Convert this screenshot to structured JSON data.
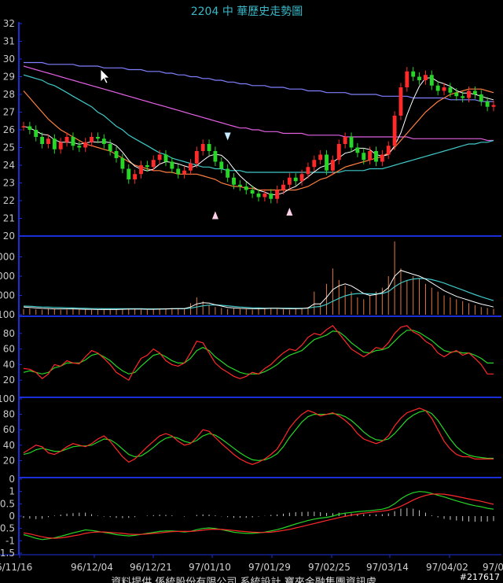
{
  "title": "2204  中    華歷史走勢圖",
  "footer": "資料提供  係統股份有限公司  系統設計  寶來金融集團資訊處",
  "watermark": "#217617",
  "colors": {
    "up": "#ff2a2a",
    "down": "#27d627",
    "frame": "#1b2fd8",
    "ma5": "#ffffff",
    "ma10": "#e0e060",
    "ma20": "#ff8040",
    "ma60": "#40c8c8",
    "ma120": "#e060e0",
    "ma240": "#8080ff"
  },
  "chart_data": [
    {
      "type": "candlestick",
      "ylim": [
        20,
        32
      ],
      "yticks": [
        "32",
        "31",
        "30",
        "29",
        "28",
        "27",
        "26",
        "25",
        "24",
        "23",
        "22",
        "21",
        "20"
      ],
      "x_labels": [
        "6/11/16",
        "96/12/04",
        "96/12/21",
        "97/01/10",
        "97/01/29",
        "97/02/25",
        "97/03/14",
        "97/04/02",
        "97/04/2"
      ],
      "close": [
        26.2,
        26.0,
        25.6,
        25.2,
        25.5,
        24.9,
        25.3,
        25.6,
        25.1,
        25.0,
        25.3,
        25.6,
        25.5,
        25.2,
        24.8,
        24.4,
        23.8,
        23.2,
        23.5,
        24.0,
        23.9,
        24.3,
        24.6,
        24.2,
        23.8,
        23.5,
        23.7,
        24.1,
        24.8,
        25.2,
        24.8,
        24.2,
        23.8,
        23.3,
        22.9,
        22.8,
        22.6,
        22.4,
        22.2,
        22.4,
        22.1,
        22.6,
        22.9,
        23.3,
        23.1,
        23.5,
        23.9,
        24.3,
        24.6,
        23.7,
        24.3,
        25.2,
        25.6,
        25.0,
        24.7,
        24.3,
        24.8,
        24.2,
        24.6,
        25.1,
        26.8,
        28.4,
        29.3,
        29.0,
        28.8,
        29.1,
        28.5,
        28.2,
        28.4,
        28.1,
        27.9,
        27.8,
        28.2,
        28.0,
        27.6,
        27.3,
        27.4
      ],
      "ma20": [
        28.2,
        27.8,
        27.4,
        27.0,
        26.6,
        26.3,
        26.0,
        25.8,
        25.6,
        25.4,
        25.2,
        25.1,
        25.0,
        24.9,
        24.8,
        24.6,
        24.4,
        24.2,
        24.0,
        23.9,
        23.8,
        23.7,
        23.7,
        23.6,
        23.6,
        23.5,
        23.5,
        23.5,
        23.5,
        23.4,
        23.3,
        23.2,
        23.0,
        22.9,
        22.8,
        22.8,
        22.7,
        22.7,
        22.6,
        22.6,
        22.6,
        22.6,
        22.6,
        22.6,
        22.6,
        22.7,
        22.8,
        23.0,
        23.2,
        23.3,
        23.5,
        23.7,
        23.9,
        24.0,
        24.1,
        24.2,
        24.3,
        24.4,
        24.5,
        24.7,
        25.0,
        25.4,
        25.8,
        26.2,
        26.6,
        27.0,
        27.3,
        27.6,
        27.8,
        28.0,
        28.1,
        28.2,
        28.3,
        28.3,
        28.3,
        28.2,
        28.1
      ],
      "ma60": [
        29.1,
        29.0,
        28.9,
        28.8,
        28.6,
        28.5,
        28.3,
        28.1,
        27.9,
        27.7,
        27.5,
        27.3,
        27.0,
        26.8,
        26.5,
        26.2,
        26.0,
        25.7,
        25.5,
        25.3,
        25.1,
        24.9,
        24.7,
        24.6,
        24.4,
        24.3,
        24.2,
        24.1,
        24.0,
        23.9,
        23.9,
        23.8,
        23.8,
        23.7,
        23.7,
        23.7,
        23.6,
        23.6,
        23.6,
        23.6,
        23.6,
        23.6,
        23.6,
        23.6,
        23.6,
        23.6,
        23.6,
        23.6,
        23.6,
        23.6,
        23.6,
        23.6,
        23.7,
        23.7,
        23.7,
        23.7,
        23.8,
        23.8,
        23.8,
        23.9,
        24.0,
        24.1,
        24.2,
        24.3,
        24.4,
        24.5,
        24.6,
        24.7,
        24.8,
        24.9,
        25.0,
        25.1,
        25.2,
        25.2,
        25.3,
        25.3,
        25.4
      ],
      "ma120": [
        29.6,
        29.5,
        29.4,
        29.3,
        29.2,
        29.1,
        29.0,
        28.9,
        28.8,
        28.7,
        28.6,
        28.5,
        28.4,
        28.3,
        28.2,
        28.1,
        28.0,
        27.9,
        27.8,
        27.7,
        27.6,
        27.5,
        27.4,
        27.3,
        27.2,
        27.1,
        27.0,
        26.9,
        26.8,
        26.7,
        26.6,
        26.5,
        26.4,
        26.3,
        26.2,
        26.1,
        26.1,
        26.0,
        26.0,
        25.9,
        25.9,
        25.9,
        25.8,
        25.8,
        25.8,
        25.8,
        25.7,
        25.7,
        25.7,
        25.7,
        25.7,
        25.7,
        25.6,
        25.6,
        25.6,
        25.6,
        25.6,
        25.6,
        25.6,
        25.6,
        25.6,
        25.6,
        25.6,
        25.5,
        25.5,
        25.5,
        25.5,
        25.5,
        25.5,
        25.5,
        25.5,
        25.5,
        25.5,
        25.5,
        25.5,
        25.4,
        25.4
      ],
      "ma240": [
        29.8,
        29.8,
        29.8,
        29.8,
        29.7,
        29.7,
        29.7,
        29.7,
        29.7,
        29.6,
        29.6,
        29.6,
        29.6,
        29.5,
        29.5,
        29.5,
        29.5,
        29.4,
        29.4,
        29.4,
        29.3,
        29.3,
        29.3,
        29.2,
        29.2,
        29.1,
        29.1,
        29.0,
        29.0,
        28.9,
        28.9,
        28.8,
        28.8,
        28.7,
        28.7,
        28.6,
        28.6,
        28.5,
        28.5,
        28.5,
        28.4,
        28.4,
        28.4,
        28.3,
        28.3,
        28.3,
        28.2,
        28.2,
        28.2,
        28.1,
        28.1,
        28.1,
        28.1,
        28.0,
        28.0,
        28.0,
        28.0,
        28.0,
        27.9,
        27.9,
        27.9,
        27.9,
        27.9,
        27.8,
        27.8,
        27.8,
        27.8,
        27.8,
        27.8,
        27.7,
        27.7,
        27.7,
        27.7,
        27.7,
        27.6,
        27.6,
        27.6
      ],
      "markers": [
        {
          "index": 33,
          "kind": "down",
          "price": 25.4
        },
        {
          "index": 31,
          "kind": "up",
          "price": 21.4
        },
        {
          "index": 43,
          "kind": "up",
          "price": 21.6
        }
      ]
    },
    {
      "type": "bar",
      "ylim": [
        0,
        4000
      ],
      "yticks": [
        "000",
        "000",
        "000",
        "100"
      ],
      "values": [
        300,
        320,
        280,
        260,
        300,
        280,
        250,
        260,
        300,
        270,
        260,
        250,
        240,
        260,
        280,
        260,
        300,
        320,
        280,
        260,
        250,
        270,
        300,
        320,
        340,
        300,
        280,
        600,
        900,
        700,
        500,
        400,
        350,
        300,
        320,
        300,
        280,
        260,
        300,
        350,
        320,
        300,
        280,
        260,
        300,
        350,
        400,
        1200,
        600,
        1600,
        2400,
        1800,
        1500,
        1200,
        900,
        800,
        1000,
        1200,
        1400,
        2000,
        3800,
        2400,
        1800,
        2000,
        1900,
        1600,
        1400,
        1200,
        1000,
        900,
        800,
        700,
        600,
        500,
        400,
        350,
        300
      ],
      "line_a": [
        400,
        380,
        350,
        330,
        320,
        300,
        300,
        300,
        300,
        290,
        280,
        280,
        270,
        270,
        270,
        270,
        280,
        290,
        290,
        290,
        280,
        280,
        290,
        300,
        310,
        320,
        320,
        400,
        560,
        620,
        600,
        520,
        450,
        380,
        350,
        330,
        320,
        310,
        310,
        320,
        330,
        330,
        320,
        310,
        310,
        320,
        350,
        560,
        560,
        900,
        1300,
        1500,
        1600,
        1500,
        1300,
        1100,
        1000,
        1050,
        1150,
        1400,
        2000,
        2300,
        2200,
        2100,
        2000,
        1850,
        1650,
        1450,
        1250,
        1100,
        950,
        850,
        750,
        650,
        550,
        480,
        400
      ],
      "line_b": [
        450,
        440,
        420,
        400,
        390,
        380,
        370,
        360,
        350,
        340,
        330,
        320,
        320,
        310,
        310,
        310,
        310,
        310,
        310,
        310,
        300,
        300,
        300,
        300,
        310,
        310,
        310,
        340,
        400,
        460,
        500,
        510,
        490,
        460,
        430,
        400,
        380,
        360,
        350,
        340,
        340,
        340,
        340,
        340,
        330,
        330,
        340,
        400,
        430,
        540,
        700,
        850,
        980,
        1060,
        1100,
        1100,
        1080,
        1080,
        1100,
        1200,
        1450,
        1650,
        1780,
        1850,
        1880,
        1870,
        1820,
        1740,
        1640,
        1520,
        1400,
        1280,
        1160,
        1040,
        930,
        830,
        730
      ]
    },
    {
      "type": "line",
      "ylim": [
        0,
        100
      ],
      "yticks": [
        "80",
        "60",
        "40",
        "20"
      ],
      "series": [
        {
          "values": [
            35,
            34,
            30,
            22,
            28,
            40,
            38,
            45,
            42,
            41,
            50,
            58,
            55,
            48,
            40,
            30,
            25,
            20,
            35,
            48,
            52,
            60,
            55,
            45,
            40,
            38,
            42,
            55,
            70,
            68,
            55,
            42,
            35,
            30,
            25,
            22,
            25,
            30,
            28,
            35,
            40,
            48,
            55,
            60,
            58,
            65,
            75,
            80,
            78,
            85,
            90,
            80,
            70,
            60,
            55,
            50,
            55,
            62,
            60,
            68,
            80,
            88,
            90,
            82,
            78,
            70,
            65,
            55,
            50,
            55,
            58,
            52,
            55,
            48,
            40,
            28,
            28
          ]
        },
        {
          "values": [
            30,
            32,
            30,
            28,
            30,
            36,
            38,
            42,
            42,
            42,
            46,
            52,
            54,
            50,
            45,
            38,
            32,
            28,
            30,
            38,
            45,
            52,
            54,
            50,
            45,
            42,
            42,
            48,
            58,
            62,
            58,
            50,
            44,
            38,
            34,
            30,
            28,
            28,
            28,
            31,
            35,
            40,
            47,
            52,
            55,
            58,
            65,
            72,
            75,
            78,
            83,
            82,
            76,
            68,
            62,
            56,
            55,
            58,
            59,
            62,
            70,
            78,
            84,
            84,
            81,
            76,
            71,
            64,
            58,
            56,
            57,
            55,
            55,
            52,
            48,
            42,
            42
          ]
        }
      ]
    },
    {
      "type": "line",
      "ylim": [
        0,
        100
      ],
      "yticks": [
        "100",
        "80",
        "60",
        "40",
        "20"
      ],
      "series": [
        {
          "values": [
            30,
            35,
            40,
            38,
            30,
            28,
            32,
            38,
            42,
            40,
            38,
            42,
            48,
            52,
            45,
            35,
            25,
            18,
            22,
            30,
            38,
            45,
            52,
            55,
            52,
            45,
            40,
            42,
            50,
            60,
            58,
            50,
            42,
            35,
            28,
            22,
            18,
            15,
            18,
            22,
            28,
            35,
            48,
            62,
            72,
            80,
            85,
            82,
            78,
            80,
            82,
            78,
            72,
            65,
            55,
            48,
            45,
            42,
            45,
            52,
            65,
            75,
            82,
            85,
            88,
            85,
            75,
            60,
            45,
            35,
            28,
            25,
            25,
            22,
            22,
            22,
            22
          ]
        },
        {
          "values": [
            28,
            30,
            34,
            36,
            34,
            32,
            32,
            35,
            38,
            39,
            39,
            40,
            44,
            48,
            47,
            42,
            35,
            28,
            25,
            26,
            31,
            37,
            44,
            49,
            51,
            49,
            45,
            43,
            46,
            52,
            55,
            53,
            48,
            42,
            36,
            30,
            25,
            21,
            20,
            21,
            24,
            29,
            38,
            50,
            60,
            70,
            77,
            80,
            80,
            80,
            81,
            80,
            77,
            72,
            65,
            57,
            51,
            47,
            46,
            48,
            55,
            64,
            73,
            79,
            83,
            85,
            81,
            72,
            60,
            48,
            38,
            31,
            27,
            25,
            24,
            23,
            23
          ]
        }
      ]
    },
    {
      "type": "line",
      "ylim": [
        -1.5,
        1.5
      ],
      "yticks": [
        "0",
        "1",
        "0.5",
        "0",
        "-0.5",
        "-1",
        "-1.5"
      ],
      "series": [
        {
          "values": [
            -0.75,
            -0.82,
            -0.9,
            -0.95,
            -0.92,
            -0.88,
            -0.82,
            -0.75,
            -0.68,
            -0.62,
            -0.56,
            -0.58,
            -0.62,
            -0.66,
            -0.7,
            -0.75,
            -0.78,
            -0.8,
            -0.78,
            -0.74,
            -0.7,
            -0.66,
            -0.62,
            -0.6,
            -0.6,
            -0.62,
            -0.64,
            -0.62,
            -0.55,
            -0.5,
            -0.48,
            -0.5,
            -0.55,
            -0.6,
            -0.65,
            -0.68,
            -0.7,
            -0.7,
            -0.68,
            -0.65,
            -0.6,
            -0.55,
            -0.48,
            -0.4,
            -0.32,
            -0.25,
            -0.18,
            -0.12,
            -0.08,
            -0.05,
            0.0,
            0.08,
            0.12,
            0.15,
            0.18,
            0.2,
            0.22,
            0.25,
            0.28,
            0.35,
            0.5,
            0.7,
            0.85,
            0.95,
            1.0,
            0.98,
            0.92,
            0.85,
            0.78,
            0.7,
            0.62,
            0.55,
            0.48,
            0.42,
            0.38,
            0.32,
            0.28
          ]
        },
        {
          "values": [
            -0.68,
            -0.72,
            -0.78,
            -0.84,
            -0.88,
            -0.9,
            -0.88,
            -0.85,
            -0.8,
            -0.76,
            -0.7,
            -0.66,
            -0.64,
            -0.64,
            -0.66,
            -0.68,
            -0.7,
            -0.73,
            -0.74,
            -0.74,
            -0.72,
            -0.7,
            -0.68,
            -0.65,
            -0.63,
            -0.62,
            -0.62,
            -0.62,
            -0.6,
            -0.57,
            -0.54,
            -0.53,
            -0.54,
            -0.56,
            -0.58,
            -0.61,
            -0.63,
            -0.65,
            -0.66,
            -0.66,
            -0.65,
            -0.62,
            -0.58,
            -0.54,
            -0.48,
            -0.42,
            -0.36,
            -0.3,
            -0.24,
            -0.18,
            -0.12,
            -0.06,
            -0.01,
            0.04,
            0.08,
            0.12,
            0.15,
            0.18,
            0.2,
            0.24,
            0.3,
            0.4,
            0.52,
            0.65,
            0.76,
            0.84,
            0.89,
            0.9,
            0.89,
            0.85,
            0.8,
            0.75,
            0.7,
            0.65,
            0.6,
            0.54,
            0.48
          ]
        }
      ],
      "histogram": [
        -0.07,
        -0.1,
        -0.12,
        -0.11,
        -0.04,
        0.02,
        0.06,
        0.1,
        0.12,
        0.14,
        0.14,
        0.08,
        0.02,
        -0.02,
        -0.04,
        -0.07,
        -0.08,
        -0.07,
        -0.04,
        0.0,
        0.02,
        0.04,
        0.06,
        0.05,
        0.03,
        0.0,
        -0.02,
        0.0,
        0.05,
        0.07,
        0.06,
        0.03,
        -0.01,
        -0.04,
        -0.07,
        -0.07,
        -0.07,
        -0.05,
        -0.02,
        0.01,
        0.05,
        0.07,
        0.1,
        0.14,
        0.16,
        0.17,
        0.18,
        0.18,
        0.16,
        0.13,
        0.12,
        0.14,
        0.13,
        0.11,
        0.1,
        0.08,
        0.07,
        0.07,
        0.08,
        0.11,
        0.2,
        0.3,
        0.33,
        0.3,
        0.24,
        0.14,
        0.03,
        -0.05,
        -0.11,
        -0.15,
        -0.18,
        -0.2,
        -0.22,
        -0.23,
        -0.22,
        -0.22,
        -0.2
      ]
    }
  ]
}
